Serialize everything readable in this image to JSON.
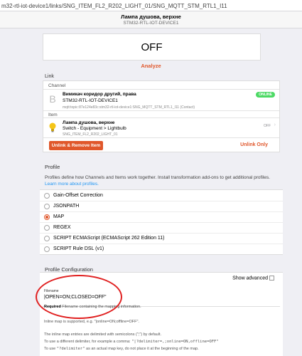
{
  "browser": {
    "url": "m32-rtl-iot-device1/links/SNG_ITEM_FL2_R202_LIGHT_01/SNG_MQTT_STM_RTL1_I11"
  },
  "nav": {
    "title": "Лампа душова, верхне",
    "subtitle": "STM32-RTL-IOT-DEVICE1"
  },
  "state": {
    "value": "OFF"
  },
  "analyze_label": "Analyze",
  "link": {
    "heading": "Link",
    "channel_label": "Channel",
    "channel": {
      "icon": "channel-b-icon",
      "icon_glyph": "B",
      "name": "Вимикач коридор другий, права",
      "thing": "STM32-RTL-IOT-DEVICE1",
      "uid": "mqtt:topic:87e124e83c:stm32-rtl-iot-device1:SNG_MQTT_STM_RTL1_I11 (Contact)",
      "status": "ONLINE",
      "status_color": "#4cd964"
    },
    "item_label": "Item",
    "item": {
      "icon": "lightbulb-icon",
      "name": "Лампа душова, верхне",
      "type": "Switch - Equipment > Lightbulb",
      "uid": "SNG_ITEM_FL2_R202_LIGHT_01",
      "state": "OFF"
    },
    "unlink_remove_label": "Unlink & Remove Item",
    "unlink_only_label": "Unlink Only"
  },
  "profile": {
    "heading": "Profile",
    "description": "Profiles define how Channels and Items work together. Install transformation add-ons to get additional profiles.",
    "learn_more": "Learn more about profiles.",
    "options": [
      "Gain-Offset Correction",
      "JSONPATH",
      "MAP",
      "REGEX",
      "SCRIPT ECMAScript (ECMAScript 262 Edition 11)",
      "SCRIPT Rule DSL (v1)"
    ],
    "selected": "MAP"
  },
  "config": {
    "heading": "Profile Configuration",
    "show_advanced": "Show advanced",
    "field_label": "Filename",
    "field_value": "|OPEN=ON;CLOSED=OFF\"",
    "required_word": "Required",
    "required_text": "Filename containing the mapping information.",
    "info1": "Inline map is supported, e.g. \"|online=ON;offline=OFF\".",
    "info2": "The inline map entries are delimited with semicolons (\";\") by default.",
    "info3_pre": "To use a different delimiter, for example a comma: ",
    "info3_code": "\"|?delimiter=,;online=ON,offline=OFF\"",
    "info4_pre": "To use ",
    "info4_code": "\"?delimiter\"",
    "info4_post": " as an actual map key, do not place it at the beginning of the map."
  },
  "colors": {
    "accent": "#e0572b",
    "annotation": "#e02020",
    "online": "#4cd964"
  }
}
